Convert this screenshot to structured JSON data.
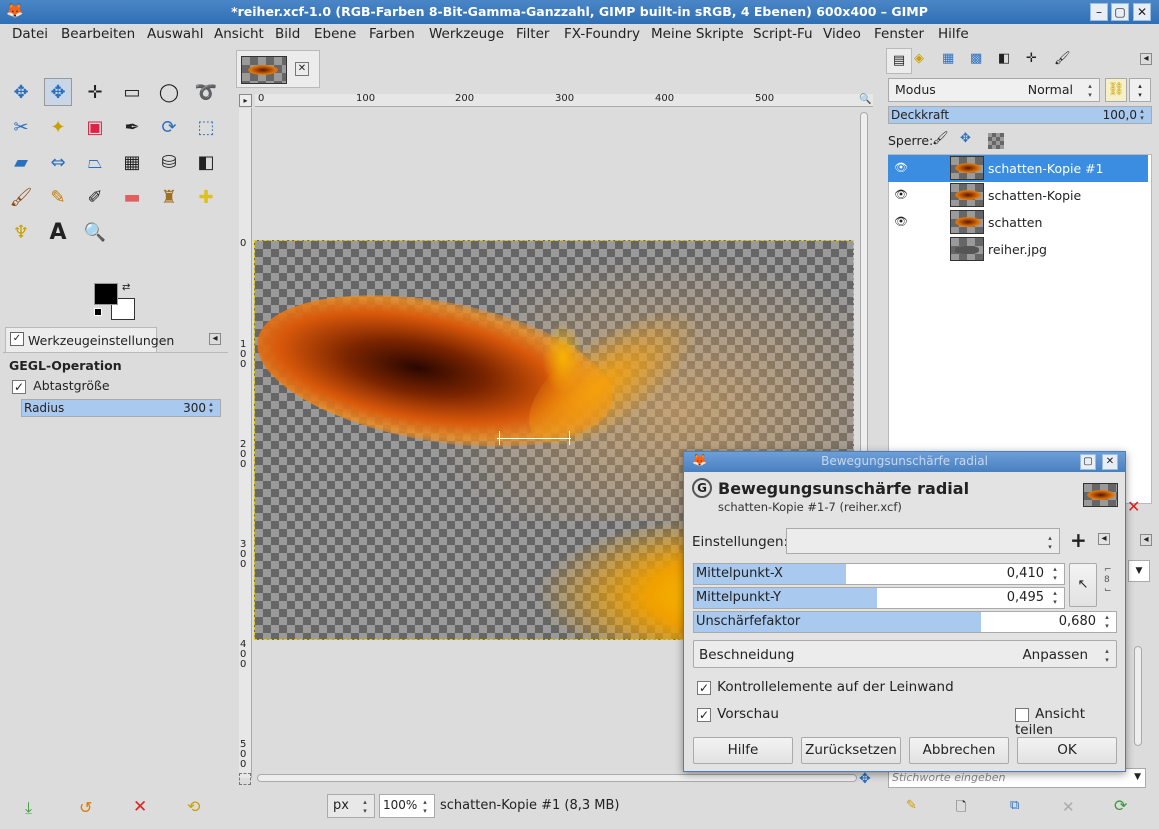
{
  "window": {
    "title": "*reiher.xcf-1.0 (RGB-Farben 8-Bit-Gamma-Ganzzahl, GIMP built-in sRGB, 4 Ebenen) 600x400 – GIMP"
  },
  "menu": [
    "Datei",
    "Bearbeiten",
    "Auswahl",
    "Ansicht",
    "Bild",
    "Ebene",
    "Farben",
    "Werkzeuge",
    "Filter",
    "FX-Foundry",
    "Meine Skripte",
    "Script-Fu",
    "Video",
    "Fenster",
    "Hilfe"
  ],
  "tool_options": {
    "tab_label": "Werkzeugeinstellungen",
    "section": "GEGL-Operation",
    "sample_label": "Abtastgröße",
    "radius_label": "Radius",
    "radius_value": "300"
  },
  "rulers": {
    "h_ticks": [
      "0",
      "100",
      "200",
      "300",
      "400",
      "500"
    ],
    "v_ticks": [
      "0",
      "1\n0\n0",
      "2\n0\n0",
      "3\n0\n0",
      "4\n0\n0",
      "5\n0\n0"
    ]
  },
  "statusbar": {
    "unit": "px",
    "zoom": "100%",
    "info": "schatten-Kopie #1 (8,3 MB)"
  },
  "layers_panel": {
    "mode_label": "Modus",
    "mode_value": "Normal",
    "opacity_label": "Deckkraft",
    "opacity_value": "100,0",
    "opacity_fraction": 1.0,
    "lock_label": "Sperre:",
    "layers": [
      {
        "name": "schatten-Kopie #1",
        "visible": true,
        "selected": true
      },
      {
        "name": "schatten-Kopie",
        "visible": true,
        "selected": false
      },
      {
        "name": "schatten",
        "visible": true,
        "selected": false
      },
      {
        "name": "reiher.jpg",
        "visible": false,
        "selected": false
      }
    ],
    "tags_placeholder": "Stichworte eingeben"
  },
  "dialog": {
    "window_title": "Bewegungsunschärfe radial",
    "heading": "Bewegungsunschärfe radial",
    "subheading": "schatten-Kopie #1-7 (reiher.xcf)",
    "presets_label": "Einstellungen:",
    "sliders": [
      {
        "label": "Mittelpunkt-X",
        "value": "0,410",
        "fraction": 0.41
      },
      {
        "label": "Mittelpunkt-Y",
        "value": "0,495",
        "fraction": 0.495
      },
      {
        "label": "Unschärfefaktor",
        "value": "0,680",
        "fraction": 0.68
      }
    ],
    "clipping_label": "Beschneidung",
    "clipping_value": "Anpassen",
    "canvas_controls": "Kontrollelemente auf der Leinwand",
    "preview": "Vorschau",
    "split_view": "Ansicht teilen",
    "buttons": {
      "help": "Hilfe",
      "reset": "Zurücksetzen",
      "cancel": "Abbrechen",
      "ok": "OK"
    }
  },
  "colors": {
    "accent": "#3a8de0",
    "selection": "#a9c9ee",
    "titlebar": "#3a7bc0"
  }
}
